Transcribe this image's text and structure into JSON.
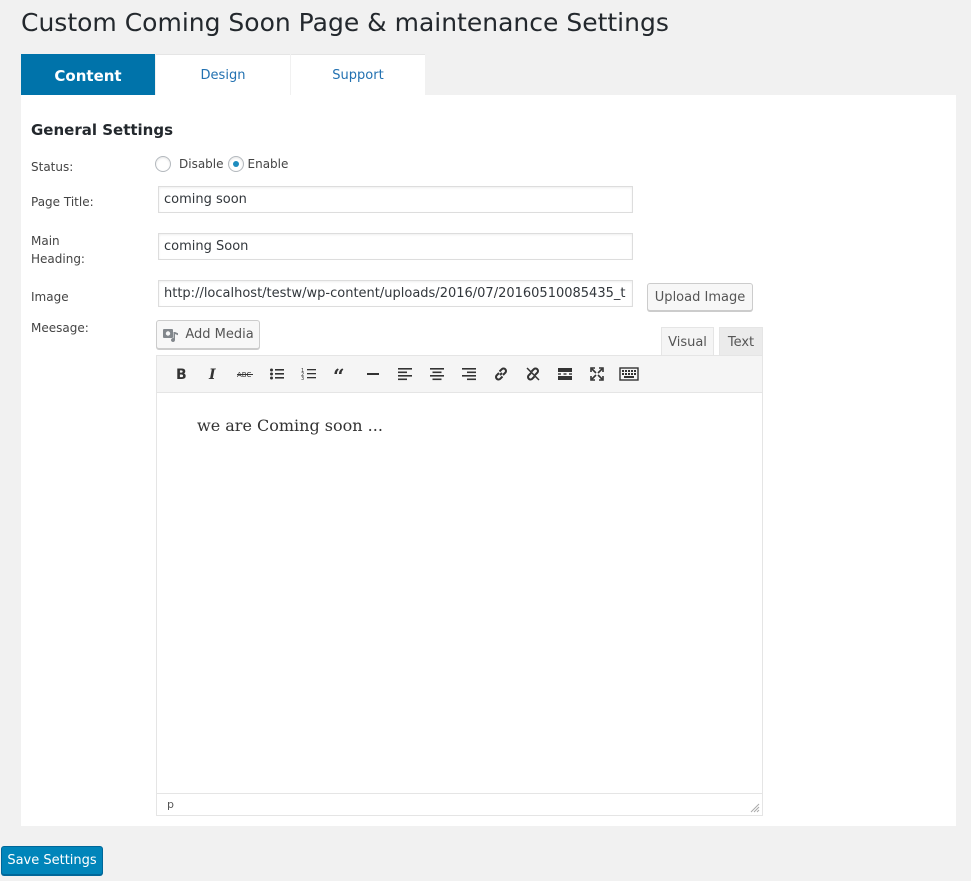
{
  "page": {
    "title": "Custom Coming Soon Page & maintenance Settings"
  },
  "tabs": [
    {
      "label": "Content",
      "active": true
    },
    {
      "label": "Design",
      "active": false
    },
    {
      "label": "Support",
      "active": false
    }
  ],
  "general": {
    "section_title": "General Settings",
    "status": {
      "label": "Status:",
      "options": [
        {
          "label": "Disable",
          "selected": false
        },
        {
          "label": "Enable",
          "selected": true
        }
      ]
    },
    "page_title": {
      "label": "Page Title:",
      "value": "coming soon"
    },
    "main_heading": {
      "label_line1": "Main",
      "label_line2": "Heading:",
      "value": "coming Soon"
    },
    "image": {
      "label": "Image",
      "value": "http://localhost/testw/wp-content/uploads/2016/07/20160510085435_t",
      "upload_label": "Upload Image"
    },
    "message": {
      "label": "Meesage:",
      "add_media_label": "Add Media",
      "tab_visual": "Visual",
      "tab_text": "Text",
      "toolbar_icons": [
        "bold-icon",
        "italic-icon",
        "strikethrough-icon",
        "bullet-list-icon",
        "numbered-list-icon",
        "blockquote-icon",
        "horizontal-rule-icon",
        "align-left-icon",
        "align-center-icon",
        "align-right-icon",
        "link-icon",
        "unlink-icon",
        "read-more-icon",
        "fullscreen-icon",
        "toolbar-toggle-icon"
      ],
      "content": "we are Coming soon ...",
      "status_path": "p"
    }
  },
  "footer": {
    "save_label": "Save Settings"
  },
  "colors": {
    "accent": "#0073aa",
    "button_primary": "#0085ba",
    "background": "#f1f1f1"
  }
}
